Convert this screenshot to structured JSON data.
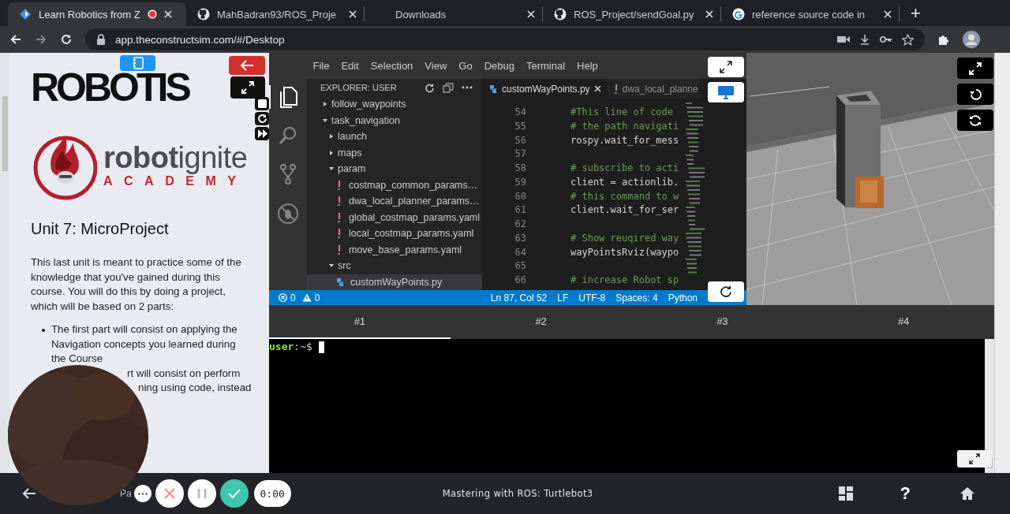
{
  "browser": {
    "tabs": [
      {
        "title": "Learn Robotics from Z",
        "selected": true,
        "recording": true
      },
      {
        "title": "MahBadran93/ROS_Proje",
        "selected": false,
        "recording": false
      },
      {
        "title": "Downloads",
        "selected": false,
        "recording": false
      },
      {
        "title": "ROS_Project/sendGoal.py",
        "selected": false,
        "recording": false
      },
      {
        "title": "reference source code in",
        "selected": false,
        "recording": false
      }
    ],
    "new_tab": "+",
    "url": "app.theconstructsim.com/#/Desktop"
  },
  "notebook": {
    "logo": "ROBOTIS",
    "brand": "**robot**ignite",
    "brand_sub": "ACADEMY",
    "heading": "Unit 7: MicroProject",
    "paragraph": "This last unit is meant to practice some of the knowledge that you've gained during this course. You will do this by doing a project, which will be based on 2 parts:",
    "bullets": [
      {
        "text": "The first part will consist on applying the Navigation concepts you learned during the Course"
      }
    ],
    "partial_lines": [
      "rt will consist on perform",
      "ning using code, instead"
    ]
  },
  "editor": {
    "menu": [
      "File",
      "Edit",
      "Selection",
      "View",
      "Go",
      "Debug",
      "Terminal",
      "Help"
    ],
    "explorer_title": "EXPLORER: USER",
    "tree": [
      {
        "label": "follow_waypoints",
        "kind": "folder",
        "expanded": false,
        "selected": false
      },
      {
        "label": "task_navigation",
        "kind": "folder",
        "expanded": true,
        "selected": false,
        "children": [
          {
            "label": "launch",
            "kind": "folder",
            "expanded": false,
            "selected": false
          },
          {
            "label": "maps",
            "kind": "folder",
            "expanded": false,
            "selected": false
          },
          {
            "label": "param",
            "kind": "folder",
            "expanded": true,
            "selected": false,
            "children": [
              {
                "label": "costmap_common_params…",
                "kind": "yaml",
                "selected": false
              },
              {
                "label": "dwa_local_planner_params…",
                "kind": "yaml",
                "selected": false
              },
              {
                "label": "global_costmap_params.yaml",
                "kind": "yaml",
                "selected": false
              },
              {
                "label": "local_costmap_params.yaml",
                "kind": "yaml",
                "selected": false
              },
              {
                "label": "move_base_params.yaml",
                "kind": "yaml",
                "selected": false
              }
            ]
          },
          {
            "label": "src",
            "kind": "folder",
            "expanded": true,
            "selected": false,
            "children": [
              {
                "label": "customWayPoints.py",
                "kind": "python",
                "selected": true
              }
            ]
          }
        ]
      }
    ],
    "tabs": [
      {
        "label": "customWayPoints.py",
        "kind": "python",
        "selected": true,
        "closable": true
      },
      {
        "label": "dwa_local_planne",
        "kind": "yaml",
        "selected": false,
        "closable": false
      }
    ],
    "lines": [
      {
        "number": "54",
        "kind": "comment",
        "code": "#This line of code"
      },
      {
        "number": "55",
        "kind": "comment",
        "code": "# the path navigati"
      },
      {
        "number": "56",
        "kind": "code",
        "code": "rospy.wait_for_mess"
      },
      {
        "number": "57",
        "kind": "blank"
      },
      {
        "number": "58",
        "kind": "comment",
        "code": "# subscribe to acti"
      },
      {
        "number": "59",
        "kind": "code",
        "code": "client = actionlib."
      },
      {
        "number": "60",
        "kind": "comment",
        "code": "# this command to w"
      },
      {
        "number": "61",
        "kind": "code",
        "code": "client.wait_for_ser"
      },
      {
        "number": "62",
        "kind": "blank"
      },
      {
        "number": "63",
        "kind": "comment",
        "code": "# Show reuqired way"
      },
      {
        "number": "64",
        "kind": "code",
        "code": "wayPointsRviz(waypo"
      },
      {
        "number": "65",
        "kind": "blank"
      },
      {
        "number": "66",
        "kind": "comment",
        "code": "# increase Robot sp"
      }
    ],
    "status": {
      "errors": "0",
      "warnings": "0",
      "items": [
        "Ln 87, Col 52",
        "LF",
        "UTF-8",
        "Spaces: 4",
        "Python"
      ]
    }
  },
  "terminal": {
    "tabs": [
      {
        "label": "#1",
        "selected": true
      },
      {
        "label": "#2",
        "selected": false
      },
      {
        "label": "#3",
        "selected": false
      },
      {
        "label": "#4",
        "selected": false
      }
    ],
    "prompt_user": "user",
    "prompt_path": ":~$"
  },
  "dock": {
    "fragment": "Pa",
    "timer": "0:00",
    "title": "Mastering with ROS: Turtlebot3",
    "help": "?"
  }
}
